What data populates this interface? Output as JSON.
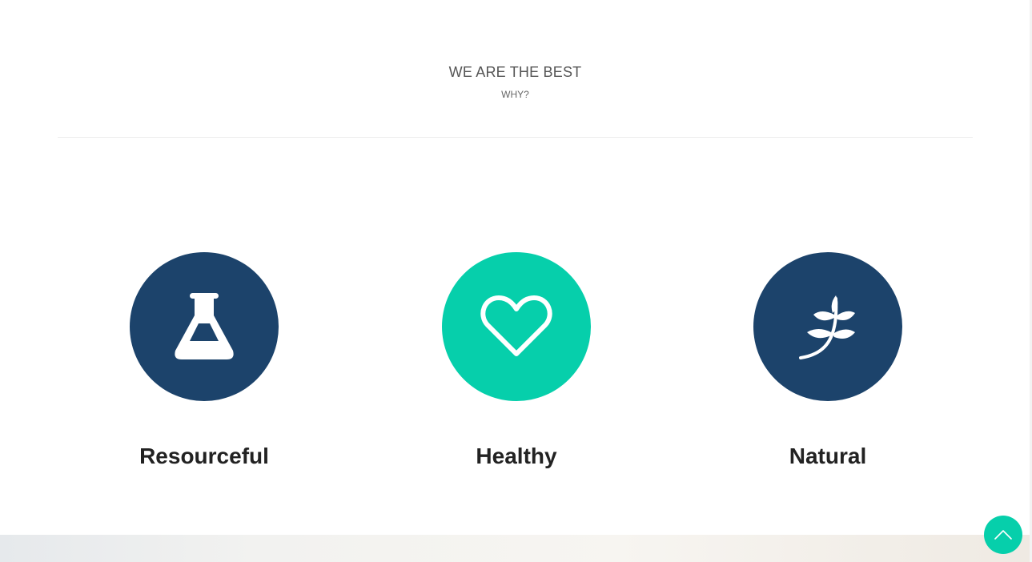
{
  "section": {
    "title": "WE ARE THE BEST",
    "subtitle": "WHY?"
  },
  "features": [
    {
      "title": "Resourceful",
      "icon": "flask-icon",
      "color": "#1c436b"
    },
    {
      "title": "Healthy",
      "icon": "heart-icon",
      "color": "#06cfab"
    },
    {
      "title": "Natural",
      "icon": "leaf-branch-icon",
      "color": "#1c436b"
    }
  ],
  "scroll_top": {
    "icon": "chevron-up-icon",
    "color": "#06cfab"
  }
}
